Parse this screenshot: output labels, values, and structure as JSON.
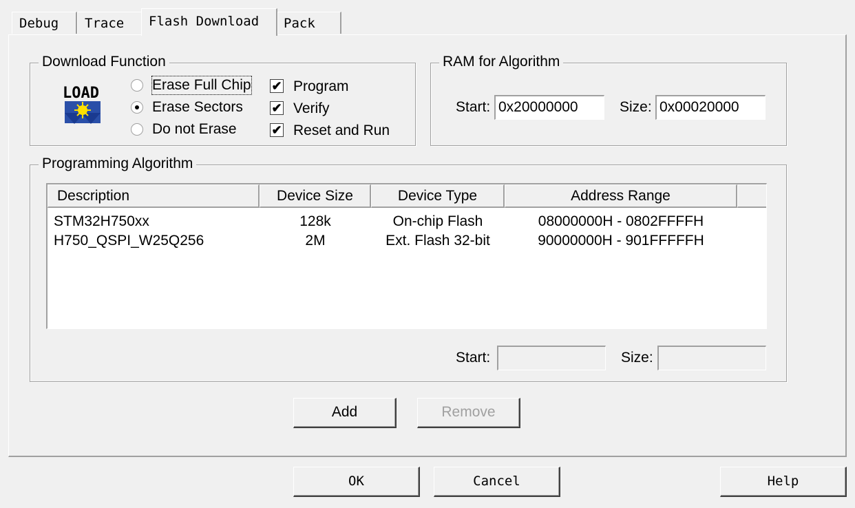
{
  "tabs": [
    "Debug",
    "Trace",
    "Flash Download",
    "Pack"
  ],
  "download_function": {
    "title": "Download Function",
    "icon_text": "LOAD",
    "radios": [
      {
        "label": "Erase Full Chip",
        "selected": false
      },
      {
        "label": "Erase Sectors",
        "selected": true
      },
      {
        "label": "Do not Erase",
        "selected": false
      }
    ],
    "checks": [
      {
        "label": "Program",
        "checked": true
      },
      {
        "label": "Verify",
        "checked": true
      },
      {
        "label": "Reset and Run",
        "checked": true
      }
    ]
  },
  "ram": {
    "title": "RAM for Algorithm",
    "start_label": "Start:",
    "start_value": "0x20000000",
    "size_label": "Size:",
    "size_value": "0x00020000"
  },
  "programming": {
    "title": "Programming Algorithm",
    "columns": [
      "Description",
      "Device Size",
      "Device Type",
      "Address Range"
    ],
    "rows": [
      [
        "STM32H750xx",
        "128k",
        "On-chip Flash",
        "08000000H - 0802FFFFH"
      ],
      [
        "H750_QSPI_W25Q256",
        "2M",
        "Ext. Flash 32-bit",
        "90000000H - 901FFFFFH"
      ]
    ],
    "start_label": "Start:",
    "start_value": "",
    "size_label": "Size:",
    "size_value": ""
  },
  "buttons": {
    "add": "Add",
    "remove": "Remove",
    "ok": "OK",
    "cancel": "Cancel",
    "help": "Help"
  }
}
